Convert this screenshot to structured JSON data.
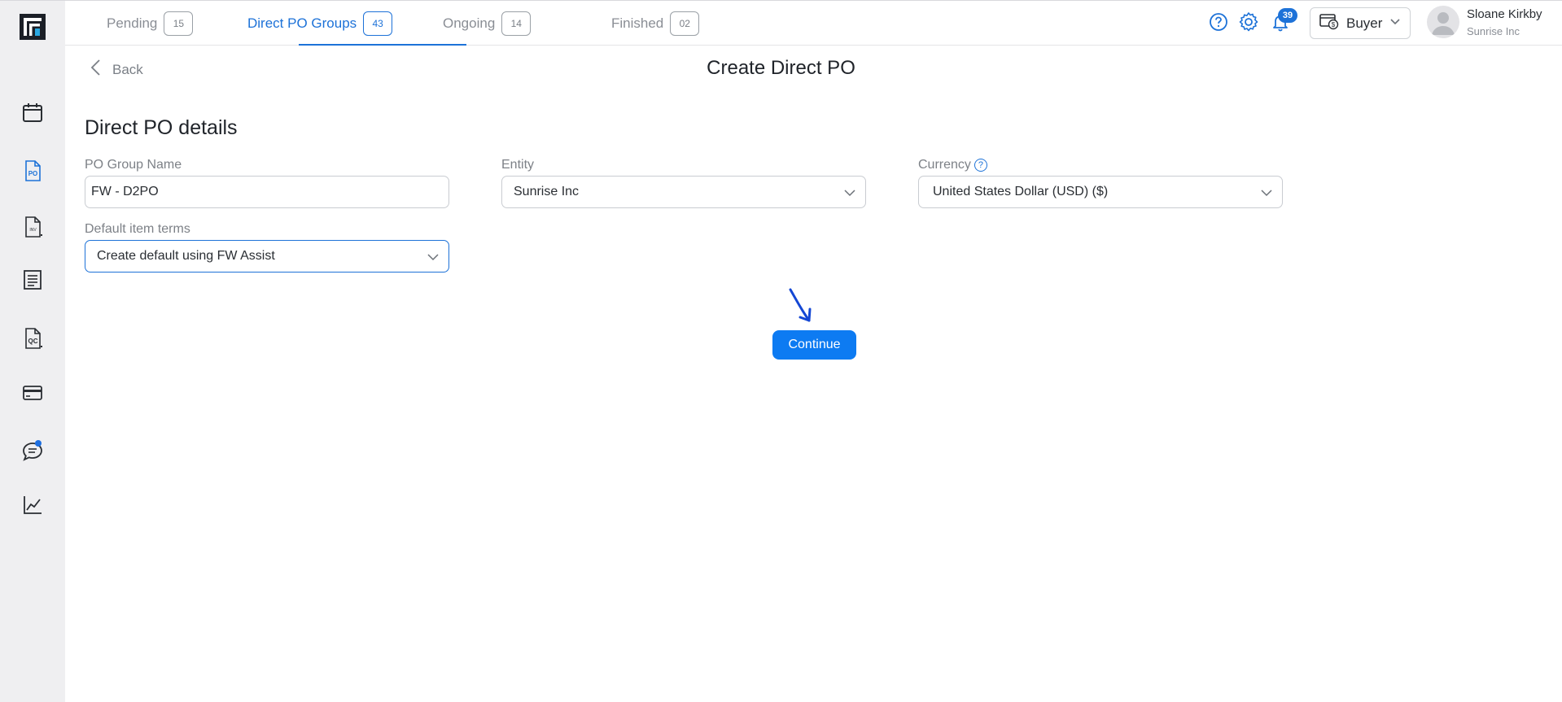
{
  "colors": {
    "accent": "#1d72d8",
    "button": "#0d7bf2",
    "sidebar_bg": "#efeff1"
  },
  "sidebar": {
    "logo_icon": "logo-icon",
    "items": [
      {
        "name": "calendar",
        "icon": "calendar-icon",
        "active": false
      },
      {
        "name": "po",
        "icon": "po-document-icon",
        "active": true
      },
      {
        "name": "invoice",
        "icon": "invoice-document-icon",
        "active": false
      },
      {
        "name": "list",
        "icon": "list-document-icon",
        "active": false
      },
      {
        "name": "qc",
        "icon": "qc-document-icon",
        "active": false
      },
      {
        "name": "payments",
        "icon": "credit-card-icon",
        "active": false
      },
      {
        "name": "chat",
        "icon": "chat-icon",
        "active": false,
        "has_notification": true
      },
      {
        "name": "analytics",
        "icon": "line-chart-icon",
        "active": false
      }
    ]
  },
  "tabs": [
    {
      "label": "Pending",
      "count": "15",
      "active": false
    },
    {
      "label": "Direct PO Groups",
      "count": "43",
      "active": true
    },
    {
      "label": "Ongoing",
      "count": "14",
      "active": false
    },
    {
      "label": "Finished",
      "count": "02",
      "active": false
    }
  ],
  "topbar": {
    "notification_count": "39",
    "role": "Buyer",
    "user_name": "Sloane Kirkby",
    "user_org": "Sunrise Inc"
  },
  "main": {
    "back_label": "Back",
    "page_title": "Create Direct PO",
    "section_title": "Direct PO details",
    "fields": {
      "po_group_name": {
        "label": "PO Group Name",
        "value": "FW - D2PO"
      },
      "entity": {
        "label": "Entity",
        "value": "Sunrise Inc"
      },
      "currency": {
        "label": "Currency",
        "value": "United States Dollar (USD) ($)"
      },
      "default_item_terms": {
        "label": "Default item terms",
        "value": "Create default using FW Assist"
      }
    },
    "continue_label": "Continue"
  }
}
